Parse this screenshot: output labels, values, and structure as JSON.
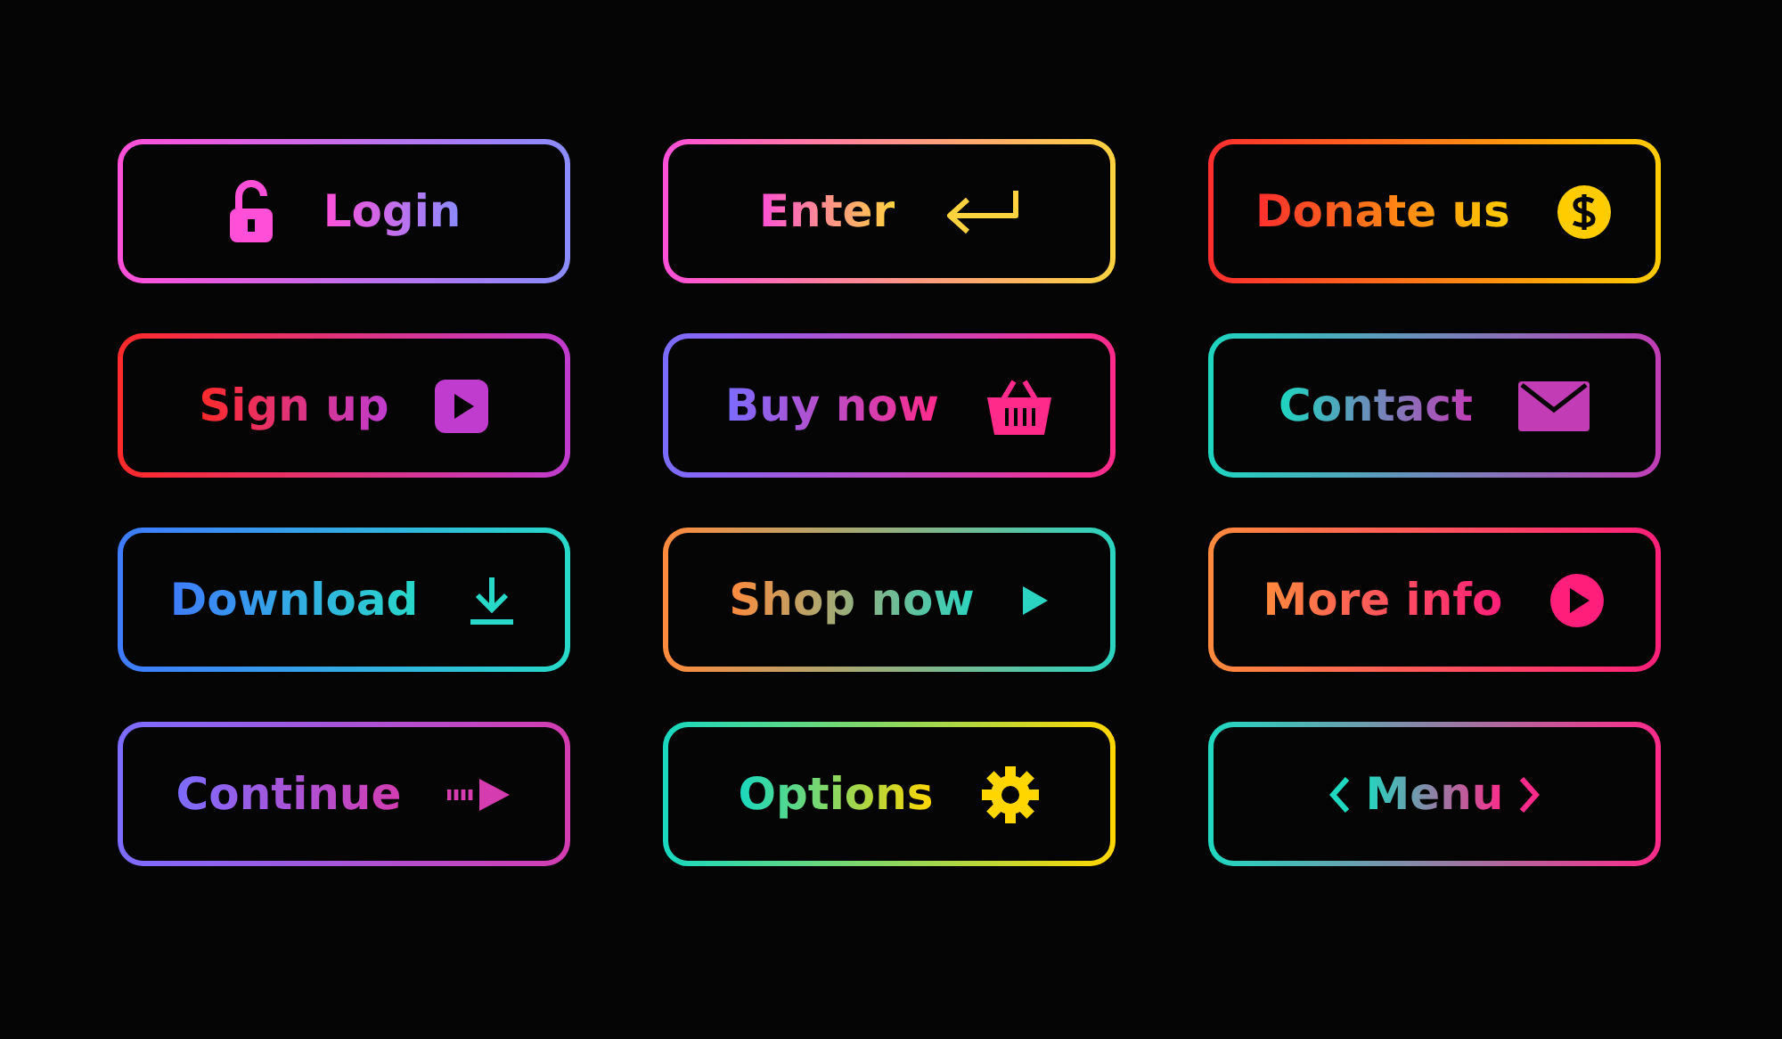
{
  "buttons": [
    {
      "label": "Login",
      "color": "#ff4fd8"
    },
    {
      "label": "Enter",
      "color": "#ff4fd8"
    },
    {
      "label": "Donate us",
      "color": "#ff2e2e"
    },
    {
      "label": "Sign up",
      "color": "#ff2a2a"
    },
    {
      "label": "Buy now",
      "color": "#7b6cff"
    },
    {
      "label": "Contact",
      "color": "#1ed6c0"
    },
    {
      "label": "Download",
      "color": "#3f7bff"
    },
    {
      "label": "Shop now",
      "color": "#ff8a3d"
    },
    {
      "label": "More info",
      "color": "#ff8a3d"
    },
    {
      "label": "Continue",
      "color": "#7c6cff"
    },
    {
      "label": "Options",
      "color": "#18d8c0"
    },
    {
      "label": "Menu",
      "color": "#20d8c0"
    }
  ]
}
